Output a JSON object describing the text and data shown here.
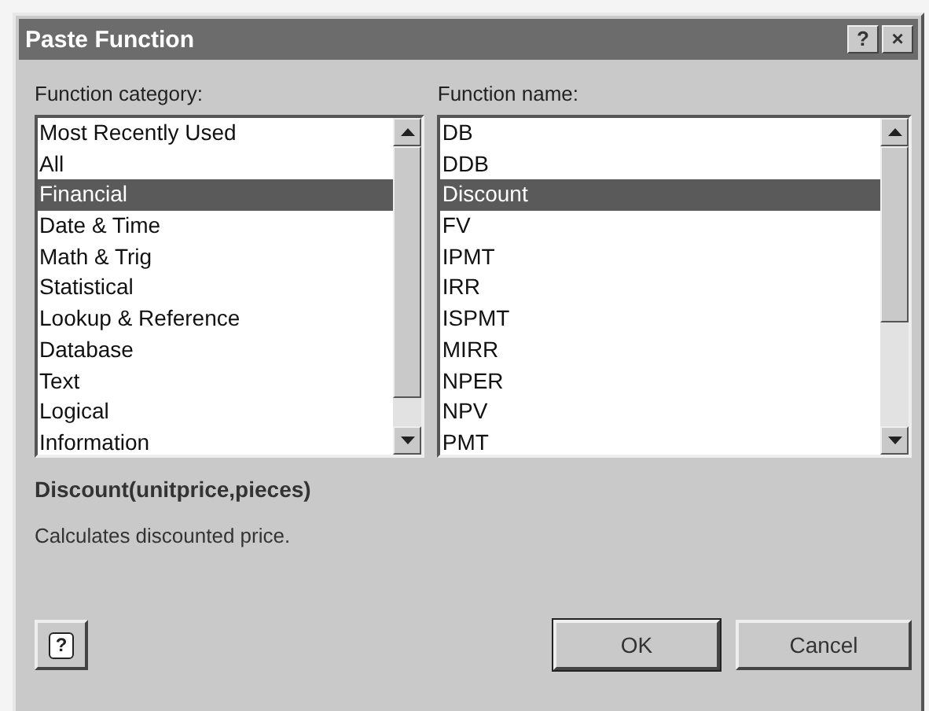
{
  "window": {
    "title": "Paste Function",
    "title_buttons": [
      "?",
      "×"
    ]
  },
  "category_list": {
    "label": "Function category:",
    "items": [
      {
        "label": "Most Recently Used",
        "selected": false
      },
      {
        "label": "All",
        "selected": false
      },
      {
        "label": "Financial",
        "selected": true
      },
      {
        "label": "Date & Time",
        "selected": false
      },
      {
        "label": "Math & Trig",
        "selected": false
      },
      {
        "label": "Statistical",
        "selected": false
      },
      {
        "label": "Lookup & Reference",
        "selected": false
      },
      {
        "label": "Database",
        "selected": false
      },
      {
        "label": "Text",
        "selected": false
      },
      {
        "label": "Logical",
        "selected": false
      },
      {
        "label": "Information",
        "selected": false
      }
    ]
  },
  "name_list": {
    "label": "Function name:",
    "items": [
      {
        "label": "DB",
        "selected": false
      },
      {
        "label": "DDB",
        "selected": false
      },
      {
        "label": "Discount",
        "selected": true
      },
      {
        "label": "FV",
        "selected": false
      },
      {
        "label": "IPMT",
        "selected": false
      },
      {
        "label": "IRR",
        "selected": false
      },
      {
        "label": "ISPMT",
        "selected": false
      },
      {
        "label": "MIRR",
        "selected": false
      },
      {
        "label": "NPER",
        "selected": false
      },
      {
        "label": "NPV",
        "selected": false
      },
      {
        "label": "PMT",
        "selected": false
      }
    ]
  },
  "signature": "Discount(unitprice,pieces)",
  "description": "Calculates discounted price.",
  "help_button": "?",
  "buttons": [
    "OK",
    "Cancel"
  ]
}
